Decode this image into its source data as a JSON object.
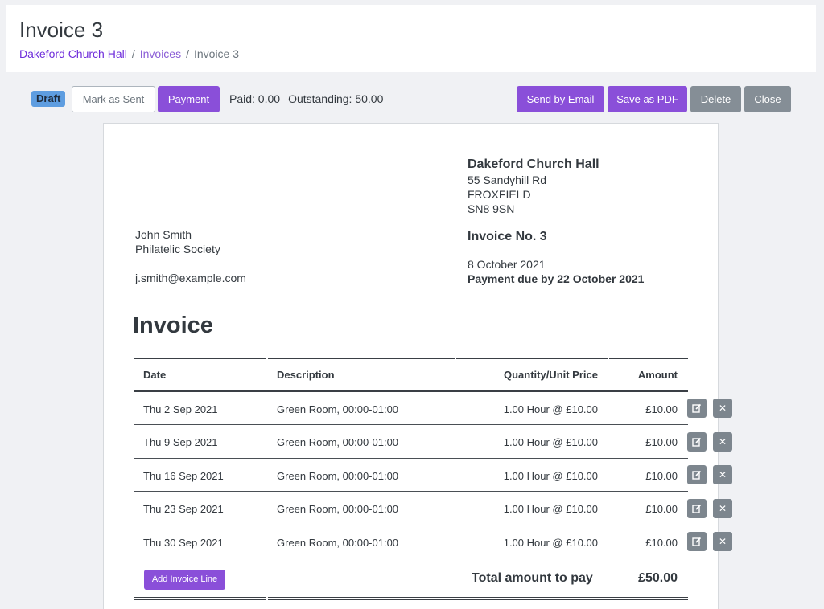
{
  "page": {
    "title": "Invoice 3",
    "breadcrumb": {
      "home": "Dakeford Church Hall",
      "section": "Invoices",
      "current": "Invoice 3",
      "separator": "/"
    }
  },
  "toolbar": {
    "status_badge": "Draft",
    "mark_sent_label": "Mark as Sent",
    "payment_label": "Payment",
    "paid": "Paid: 0.00",
    "outstanding": "Outstanding: 50.00",
    "send_email_label": "Send by Email",
    "save_pdf_label": "Save as PDF",
    "delete_label": "Delete",
    "close_label": "Close"
  },
  "invoice": {
    "org": {
      "name": "Dakeford Church Hall",
      "address_line1": "55 Sandyhill Rd",
      "address_line2": "FROXFIELD",
      "postcode": "SN8 9SN"
    },
    "number": "Invoice No. 3",
    "date": "8 October 2021",
    "due": "Payment due by 22 October 2021",
    "recipient": {
      "name": "John Smith",
      "organisation": "Philatelic Society",
      "email": "j.smith@example.com"
    },
    "heading": "Invoice",
    "table": {
      "headers": {
        "date": "Date",
        "description": "Description",
        "quantity": "Quantity/Unit Price",
        "amount": "Amount"
      },
      "rows": [
        {
          "date": "Thu 2 Sep 2021",
          "description": "Green Room, 00:00-01:00",
          "quantity": "1.00 Hour @ £10.00",
          "amount": "£10.00"
        },
        {
          "date": "Thu 9 Sep 2021",
          "description": "Green Room, 00:00-01:00",
          "quantity": "1.00 Hour @ £10.00",
          "amount": "£10.00"
        },
        {
          "date": "Thu 16 Sep 2021",
          "description": "Green Room, 00:00-01:00",
          "quantity": "1.00 Hour @ £10.00",
          "amount": "£10.00"
        },
        {
          "date": "Thu 23 Sep 2021",
          "description": "Green Room, 00:00-01:00",
          "quantity": "1.00 Hour @ £10.00",
          "amount": "£10.00"
        },
        {
          "date": "Thu 30 Sep 2021",
          "description": "Green Room, 00:00-01:00",
          "quantity": "1.00 Hour @ £10.00",
          "amount": "£10.00"
        }
      ],
      "add_line_label": "Add Invoice Line",
      "total_label": "Total amount to pay",
      "total_value": "£50.00"
    },
    "icons": {
      "edit": "edit-icon",
      "delete": "close-icon"
    }
  },
  "colors": {
    "accent": "#8a4fd9",
    "grey_button": "#858e96",
    "draft_badge": "#5e9de0",
    "breadcrumb_link": "#6f2ddb"
  }
}
